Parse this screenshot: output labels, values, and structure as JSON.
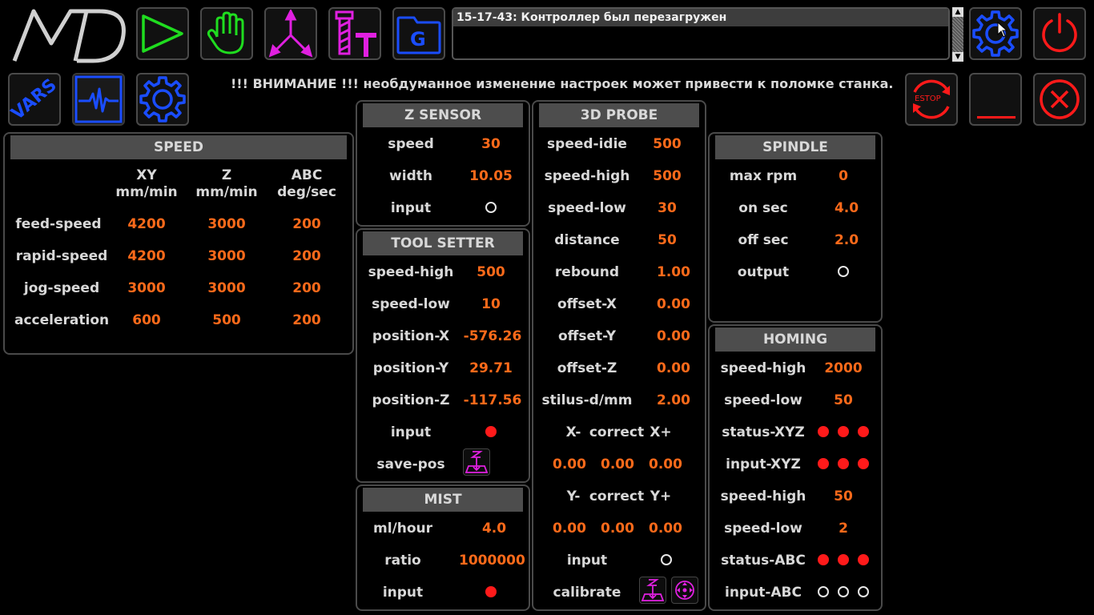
{
  "colors": {
    "accent": "#ff6a1a",
    "green": "#1fdc1f",
    "magenta": "#e020e0",
    "blue": "#1a4dff",
    "red": "#ff1a1a"
  },
  "icons": {
    "logo": "md-logo",
    "run": "play-icon",
    "manual": "hand-icon",
    "axes": "axes-icon",
    "tool": "tool-icon",
    "gcode": "gcode-folder-icon",
    "settings_top": "gear-icon",
    "power": "power-icon",
    "vars": "vars-icon",
    "scope": "pulse-icon",
    "settings": "gear-icon",
    "estop": "estop-icon",
    "minimize": "minimize-icon",
    "close": "close-icon"
  },
  "vars_label": "VARS",
  "gcode_label": "G",
  "estop_label": "ESTOP",
  "message": "15-17-43: Контроллер был перезагружен",
  "warning": "!!! ВНИМАНИЕ !!!  необдуманное изменение настроек может привести к поломке станка.",
  "speed": {
    "title": "SPEED",
    "headers": [
      {
        "axis": "XY",
        "unit": "mm/min"
      },
      {
        "axis": "Z",
        "unit": "mm/min"
      },
      {
        "axis": "ABC",
        "unit": "deg/sec"
      }
    ],
    "rows": [
      {
        "label": "feed-speed",
        "values": [
          "4200",
          "3000",
          "200"
        ]
      },
      {
        "label": "rapid-speed",
        "values": [
          "4200",
          "3000",
          "200"
        ]
      },
      {
        "label": "jog-speed",
        "values": [
          "3000",
          "3000",
          "200"
        ]
      },
      {
        "label": "acceleration",
        "values": [
          "600",
          "500",
          "200"
        ]
      }
    ]
  },
  "zsensor": {
    "title": "Z SENSOR",
    "rows": [
      {
        "label": "speed",
        "value": "30"
      },
      {
        "label": "width",
        "value": "10.05"
      },
      {
        "label": "input",
        "dot": "off"
      }
    ]
  },
  "toolsetter": {
    "title": "TOOL SETTER",
    "rows": [
      {
        "label": "speed-high",
        "value": "500"
      },
      {
        "label": "speed-low",
        "value": "10"
      },
      {
        "label": "position-X",
        "value": "-576.26"
      },
      {
        "label": "position-Y",
        "value": "29.71"
      },
      {
        "label": "position-Z",
        "value": "-117.56"
      },
      {
        "label": "input",
        "dot": "on"
      },
      {
        "label": "save-pos",
        "button": "z-probe-icon"
      }
    ]
  },
  "mist": {
    "title": "MIST",
    "rows": [
      {
        "label": "ml/hour",
        "value": "4.0"
      },
      {
        "label": "ratio",
        "value": "1000000"
      },
      {
        "label": "input",
        "dot": "on"
      }
    ]
  },
  "probe": {
    "title": "3D PROBE",
    "rows": [
      {
        "label": "speed-idie",
        "value": "500"
      },
      {
        "label": "speed-high",
        "value": "500"
      },
      {
        "label": "speed-low",
        "value": "30"
      },
      {
        "label": "distance",
        "value": "50"
      },
      {
        "label": "rebound",
        "value": "1.00"
      },
      {
        "label": "offset-X",
        "value": "0.00"
      },
      {
        "label": "offset-Y",
        "value": "0.00"
      },
      {
        "label": "offset-Z",
        "value": "0.00"
      },
      {
        "label": "stilus-d/mm",
        "value": "2.00"
      }
    ],
    "correct_x": {
      "labels": [
        "X-",
        "correct",
        "X+"
      ],
      "values": [
        "0.00",
        "0.00",
        "0.00"
      ]
    },
    "correct_y": {
      "labels": [
        "Y-",
        "correct",
        "Y+"
      ],
      "values": [
        "0.00",
        "0.00",
        "0.00"
      ]
    },
    "input_label": "input",
    "input_dot": "off",
    "calibrate_label": "calibrate"
  },
  "spindle": {
    "title": "SPINDLE",
    "rows": [
      {
        "label": "max rpm",
        "value": "0"
      },
      {
        "label": "on sec",
        "value": "4.0"
      },
      {
        "label": "off sec",
        "value": "2.0"
      },
      {
        "label": "output",
        "dot": "off"
      }
    ]
  },
  "homing": {
    "title": "HOMING",
    "rows": [
      {
        "label": "speed-high",
        "value": "2000"
      },
      {
        "label": "speed-low",
        "value": "50"
      },
      {
        "label": "status-XYZ",
        "dots": [
          "on",
          "on",
          "on"
        ]
      },
      {
        "label": "input-XYZ",
        "dots": [
          "on",
          "on",
          "on"
        ]
      },
      {
        "label": "speed-high",
        "value": "50"
      },
      {
        "label": "speed-low",
        "value": "2"
      },
      {
        "label": "status-ABC",
        "dots": [
          "on",
          "on",
          "on"
        ]
      },
      {
        "label": "input-ABC",
        "dots": [
          "off",
          "off",
          "off"
        ]
      }
    ]
  }
}
